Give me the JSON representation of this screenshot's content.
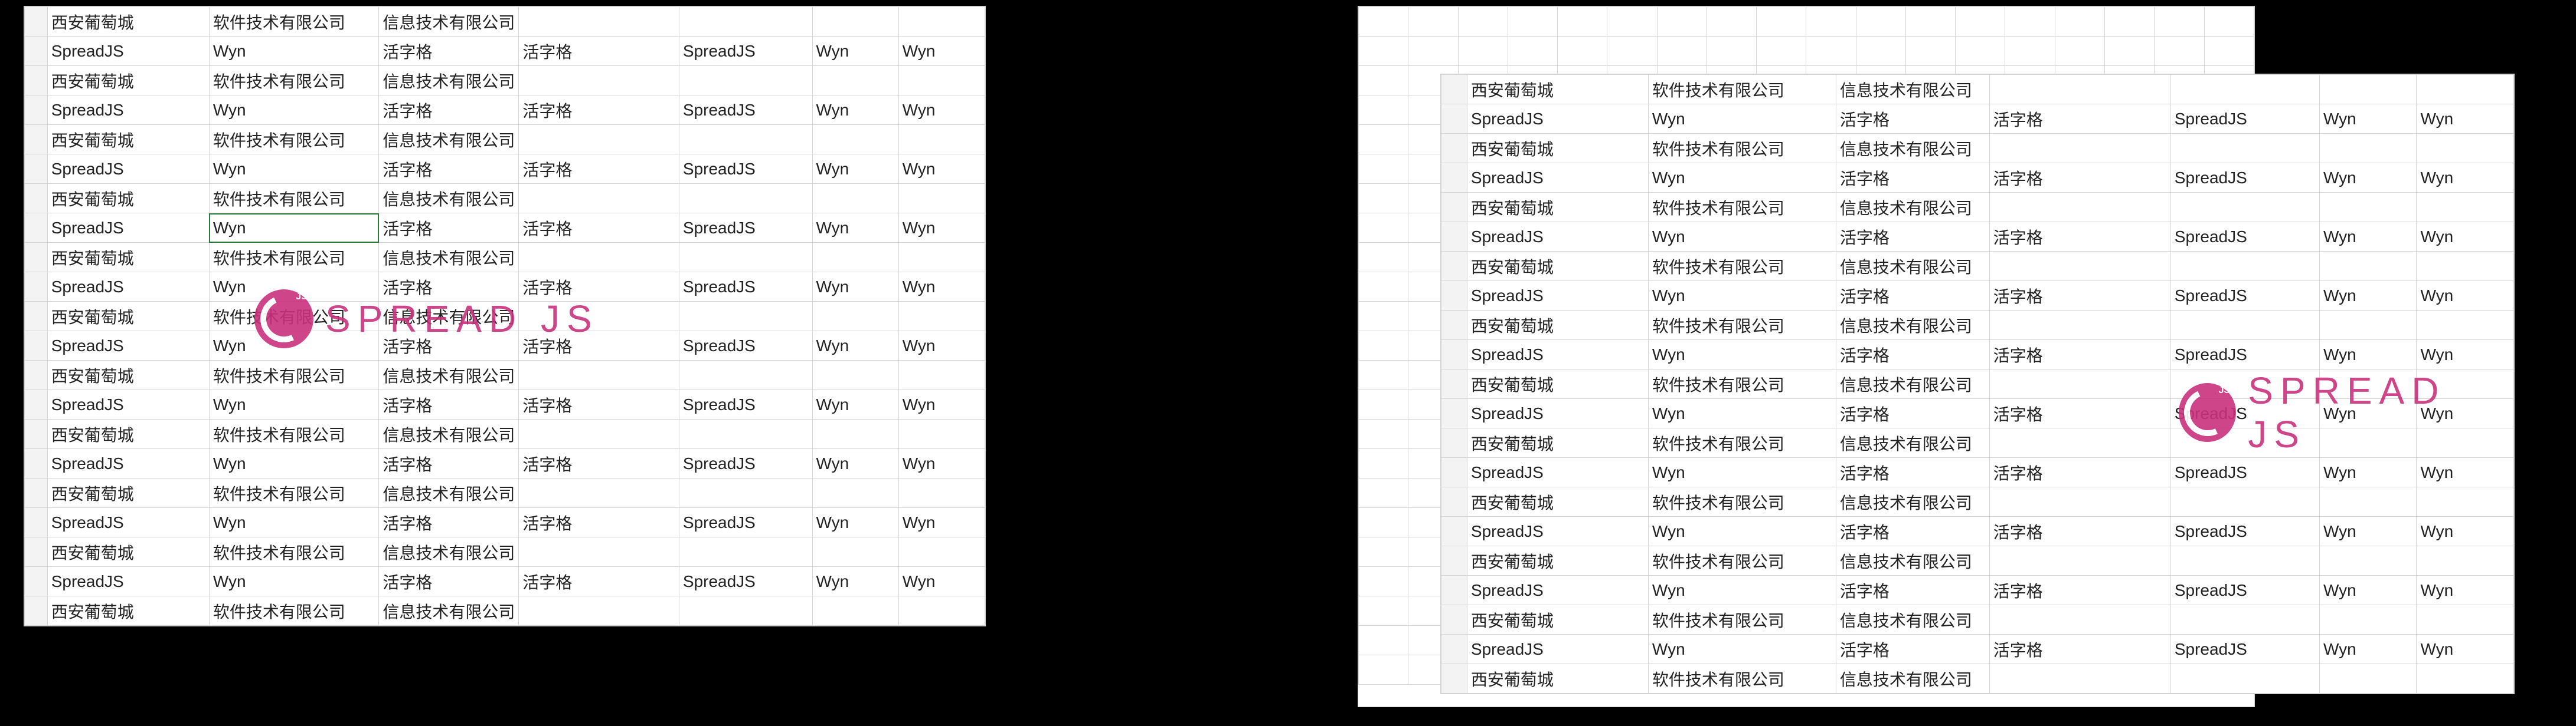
{
  "watermark": {
    "badge": "JS",
    "text": "SPREAD JS"
  },
  "rowTypeA": {
    "a": "西安葡萄城",
    "b": "软件技术有限公司",
    "c": "信息技术有限公司",
    "d": "",
    "e": "",
    "f": "",
    "g": ""
  },
  "rowTypeB": {
    "a": "SpreadJS",
    "b": "Wyn",
    "c": "活字格",
    "d": "活字格",
    "e": "SpreadJS",
    "f": "Wyn",
    "g": "Wyn"
  },
  "leftSheet": {
    "rowCount": 21,
    "selectedCell": {
      "row": 7,
      "col": 1
    }
  },
  "rightBackSheet": {
    "rowCount": 23,
    "cols": 18
  },
  "rightSheet": {
    "rowCount": 21
  }
}
